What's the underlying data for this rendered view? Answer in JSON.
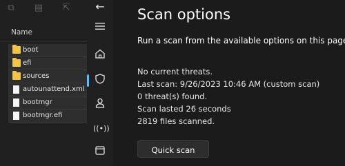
{
  "explorer": {
    "column_header": "Name",
    "items": [
      {
        "name": "boot",
        "type": "folder"
      },
      {
        "name": "efi",
        "type": "folder"
      },
      {
        "name": "sources",
        "type": "folder"
      },
      {
        "name": "autounattend.xml",
        "type": "file"
      },
      {
        "name": "bootmgr",
        "type": "file"
      },
      {
        "name": "bootmgr.efi",
        "type": "file"
      }
    ],
    "toolbar_icons": [
      "copy-icon",
      "paste-icon",
      "share-icon"
    ]
  },
  "rail": {
    "icons": [
      "back-icon",
      "menu-icon",
      "home-icon",
      "shield-icon",
      "account-icon",
      "network-icon",
      "app-browser-icon"
    ],
    "active": "shield-icon"
  },
  "main": {
    "title": "Scan options",
    "subtitle": "Run a scan from the available options on this page.",
    "status": {
      "threats": "No current threats.",
      "last_scan": "Last scan: 9/26/2023 10:46 AM (custom scan)",
      "found": "0 threat(s) found.",
      "duration": "Scan lasted 26 seconds",
      "files": "2819 files scanned."
    },
    "quick_scan_label": "Quick scan"
  },
  "colors": {
    "accent": "#4cc2ff",
    "folder": "#f3c443",
    "background": "#1b1b1b"
  }
}
